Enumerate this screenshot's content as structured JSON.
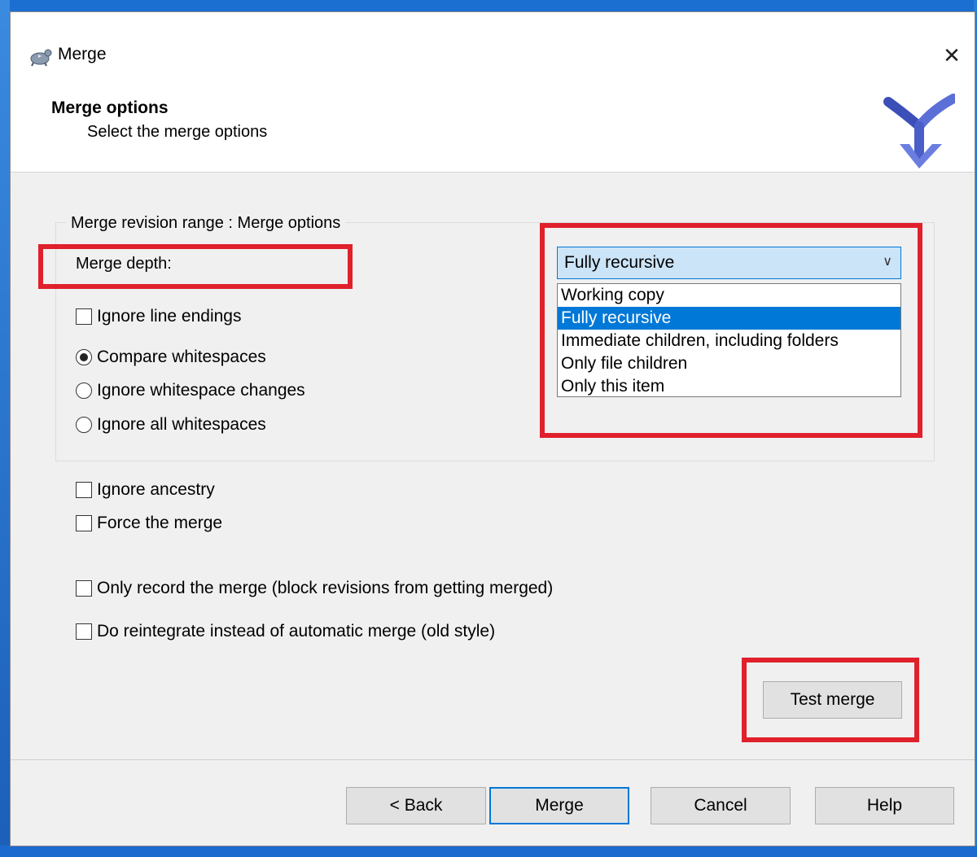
{
  "window": {
    "title": "Merge"
  },
  "header": {
    "title": "Merge options",
    "subtitle": "Select the merge options"
  },
  "group": {
    "label": "Merge revision range : Merge options",
    "depth_label": "Merge depth:",
    "depth_select": {
      "value": "Fully recursive",
      "options": [
        "Working copy",
        "Fully recursive",
        "Immediate children, including folders",
        "Only file children",
        "Only this item"
      ],
      "selected_index": 1
    },
    "ignore_line_endings": "Ignore line endings",
    "whitespace": {
      "compare": "Compare whitespaces",
      "ignore_changes": "Ignore whitespace changes",
      "ignore_all": "Ignore all whitespaces",
      "selected": "compare"
    }
  },
  "options": {
    "ignore_ancestry": "Ignore ancestry",
    "force_merge": "Force the merge",
    "only_record": "Only record the merge (block revisions from getting merged)",
    "reintegrate": "Do reintegrate instead of automatic merge (old style)"
  },
  "buttons": {
    "test_merge": "Test merge",
    "back": "< Back",
    "merge": "Merge",
    "cancel": "Cancel",
    "help": "Help"
  },
  "icons": {
    "app": "tortoise-icon",
    "logo": "merge-logo-icon",
    "close": "close-icon",
    "dropdown": "chevron-down-icon"
  },
  "colors": {
    "highlight": "#e0202b",
    "accent": "#0078d7"
  }
}
